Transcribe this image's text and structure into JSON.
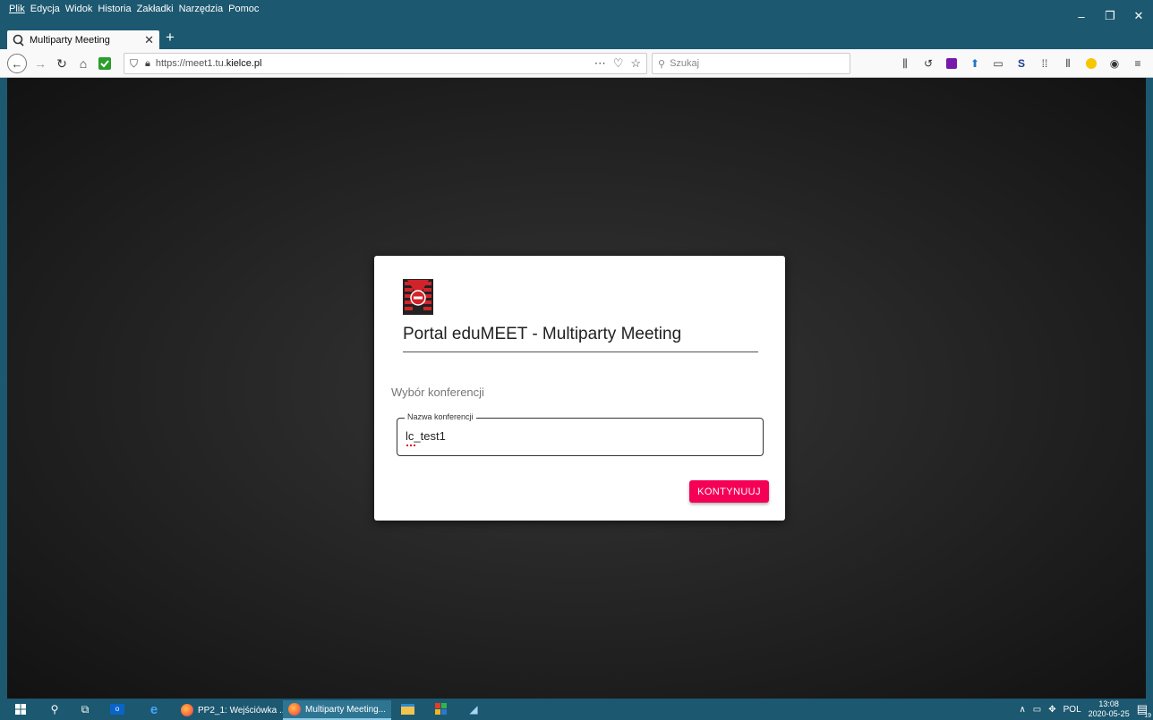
{
  "menubar": {
    "items": [
      "Plik",
      "Edycja",
      "Widok",
      "Historia",
      "Zakładki",
      "Narzędzia",
      "Pomoc"
    ]
  },
  "window_controls": {
    "minimize": "–",
    "restore": "❐",
    "close": "✕"
  },
  "tab": {
    "title": "Multiparty Meeting",
    "close": "✕",
    "new_tab": "+"
  },
  "navbar": {
    "url_host_prefix": "https://meet1.tu.",
    "url_host_domain": "kielce.pl",
    "search_placeholder": "Szukaj"
  },
  "card": {
    "title": "Portal eduMEET - Multiparty Meeting",
    "subtitle": "Wybór konferencji",
    "field_label": "Nazwa konferencji",
    "field_value": "lc_test1",
    "continue_label": "KONTYNUUJ"
  },
  "taskbar": {
    "apps": [
      {
        "label": "PP2_1: Wejściówka ..."
      },
      {
        "label": "Multiparty Meeting..."
      }
    ],
    "language": "POL",
    "time": "13:08",
    "date": "2020-05-25",
    "notification_count": "19"
  },
  "colors": {
    "accent": "#f50057",
    "chrome": "#1c5870"
  }
}
